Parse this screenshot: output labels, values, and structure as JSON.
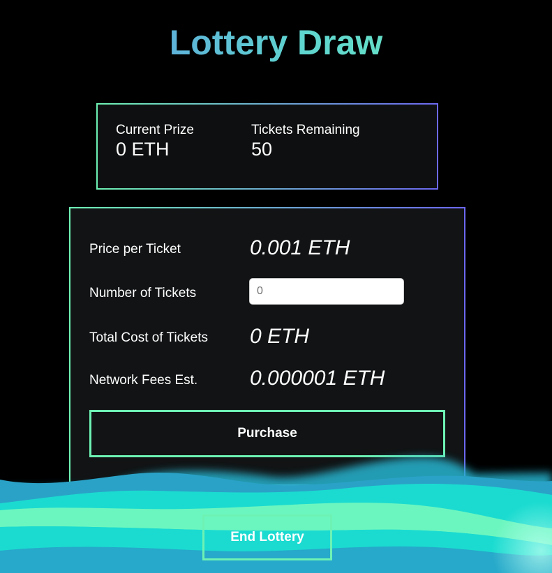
{
  "header": {
    "title": "Lottery Draw"
  },
  "stats": {
    "prize_label": "Current Prize",
    "prize_value": "0 ETH",
    "tickets_label": "Tickets Remaining",
    "tickets_value": "50"
  },
  "purchase_form": {
    "price_label": "Price per Ticket",
    "price_value": "0.001 ETH",
    "quantity_label": "Number of Tickets",
    "quantity_placeholder": "0",
    "total_label": "Total Cost of Tickets",
    "total_value": "0 ETH",
    "fees_label": "Network Fees Est.",
    "fees_value": "0.000001 ETH",
    "purchase_button": "Purchase"
  },
  "footer": {
    "end_button": "End Lottery"
  },
  "colors": {
    "background": "#000000",
    "panel": "#111314",
    "accent_green": "#6ef2b4",
    "accent_purple": "#6c68f0",
    "title_gradient_start": "#5b86e5",
    "title_gradient_end": "#6ff0b9",
    "wave_teal": "#1bdcd0",
    "wave_mint": "#6cf6bf",
    "wave_blue": "#26a8c9"
  }
}
